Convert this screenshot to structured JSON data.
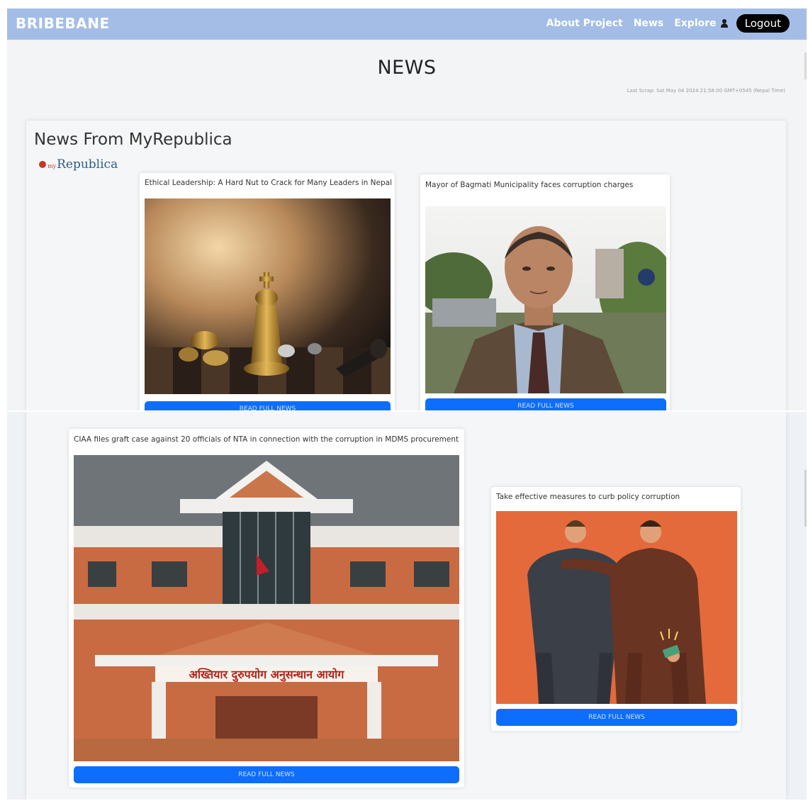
{
  "navbar": {
    "brand": "BRIBEBANE",
    "links": [
      "About Project",
      "News",
      "Explore"
    ],
    "logout_label": "Logout"
  },
  "page": {
    "title": "NEWS",
    "last_scrap": "Last Scrap: Sat May 04 2024 21:58:00 GMT+0545 (Nepal Time)"
  },
  "section": {
    "title": "News From MyRepublica",
    "logo_my": "my",
    "logo_name": "Republica"
  },
  "cards": [
    {
      "title": "Ethical Leadership: A Hard Nut to Crack for Many Leaders in Nepal",
      "button": "READ FULL NEWS"
    },
    {
      "title": "Mayor of Bagmati Municipality faces corruption charges",
      "button": "READ FULL NEWS"
    },
    {
      "title": "CIAA files graft case against 20 officials of NTA in connection with the corruption in MDMS procurement",
      "button": "READ FULL NEWS",
      "sign_text": "अख्तियार दुरुपयोग अनुसन्धान आयोग"
    },
    {
      "title": "Take effective measures to curb policy corruption",
      "button": "READ FULL NEWS"
    }
  ],
  "colors": {
    "navbar": "#a3bde6",
    "button": "#0d6efd",
    "logout": "#000000"
  }
}
